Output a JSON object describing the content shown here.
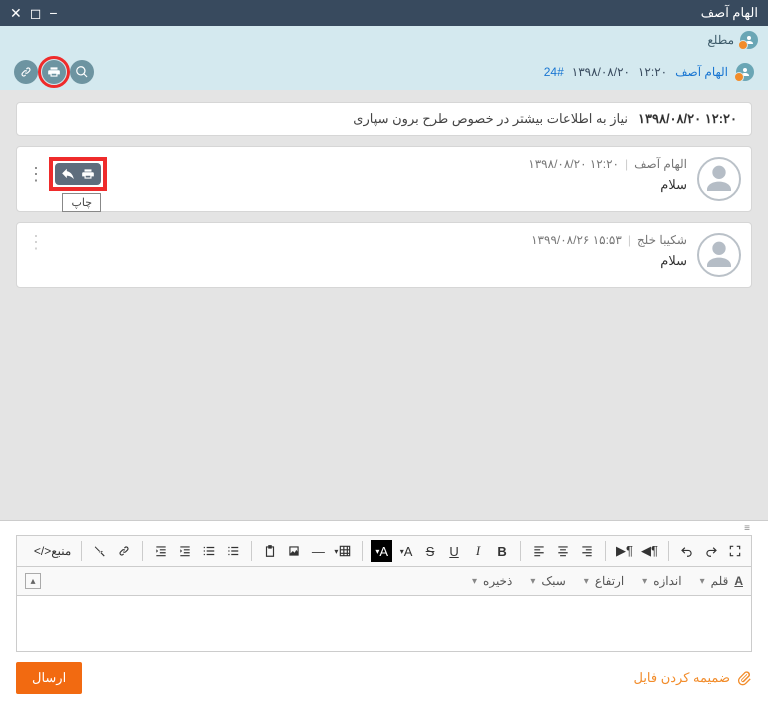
{
  "window": {
    "title": "الهام آصف"
  },
  "role": {
    "label": "مطلع"
  },
  "header": {
    "author": "الهام آصف",
    "date": "۱۳۹۸/۰۸/۲۰",
    "time": "۱۲:۲۰",
    "ticket_id": "24#"
  },
  "subject": {
    "date": "۱۳۹۸/۰۸/۲۰",
    "time": "۱۲:۲۰",
    "text": "نیاز به اطلاعات بیشتر در خصوص طرح برون سپاری"
  },
  "messages": [
    {
      "name": "الهام آصف",
      "date": "۱۳۹۸/۰۸/۲۰",
      "time": "۱۲:۲۰",
      "text": "سلام"
    },
    {
      "name": "شکیبا خلج",
      "date": "۱۳۹۹/۰۸/۲۶",
      "time": "۱۵:۵۳",
      "text": "سلام"
    }
  ],
  "tooltip": {
    "print": "چاپ"
  },
  "editor": {
    "source_label": "منبع",
    "font_label": "قلم",
    "size_label": "اندازه",
    "height_label": "ارتفاع",
    "style_label": "سبک",
    "save_label": "ذخیره"
  },
  "footer": {
    "attach_label": "ضمیمه کردن فایل",
    "send_label": "ارسال"
  }
}
